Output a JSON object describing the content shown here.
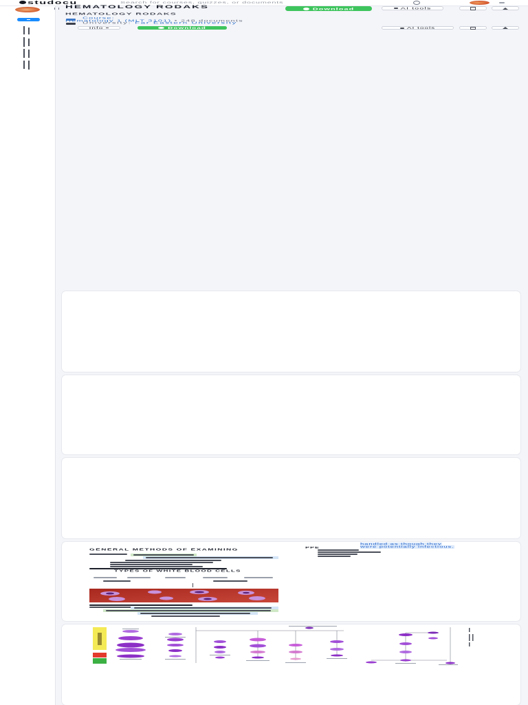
{
  "header": {
    "logo_text": "studocu",
    "search_placeholder": "Search for courses, quizzes, or documents"
  },
  "document": {
    "title": "HEMATOLOGY RODAKS",
    "subtitle": "HEMATOLOGY RODAKS",
    "course_label": "Course:",
    "course_name": "Hematology 1 (MLT 3101)",
    "separator": "•",
    "document_count": "248 documents",
    "university_label": "University:",
    "university_name": "Far Eastern University"
  },
  "actions": {
    "download": "Download",
    "ai_tools": "AI tools",
    "info": "Info"
  },
  "page_4": {
    "note_line_1": "handled as though they",
    "note_line_2": "were potentially infectious.",
    "ppe_heading": "PPE",
    "heading_1": "GENERAL METHODS OF EXAMINING",
    "heading_2": "TYPES OF WHITE BLOOD CELLS"
  },
  "icons": {
    "logo": "studocu-logo-icon",
    "search": "search-icon",
    "download": "cloud-download-icon",
    "ai_tools": "sparkle-icon",
    "bookmark": "bookmark-icon",
    "share": "share-icon",
    "info_chevron": "chevron-down-icon",
    "sidebar_collapse": "double-chevron-left-icon",
    "create": "plus-icon"
  },
  "colors": {
    "download_green": "#3ec45d",
    "link_blue": "#2f72c9",
    "create_blue": "#1a8cff",
    "page_background": "#f4f5f9",
    "highlight_green": "#cfe8c6",
    "highlight_blue": "#d3e4f6"
  }
}
